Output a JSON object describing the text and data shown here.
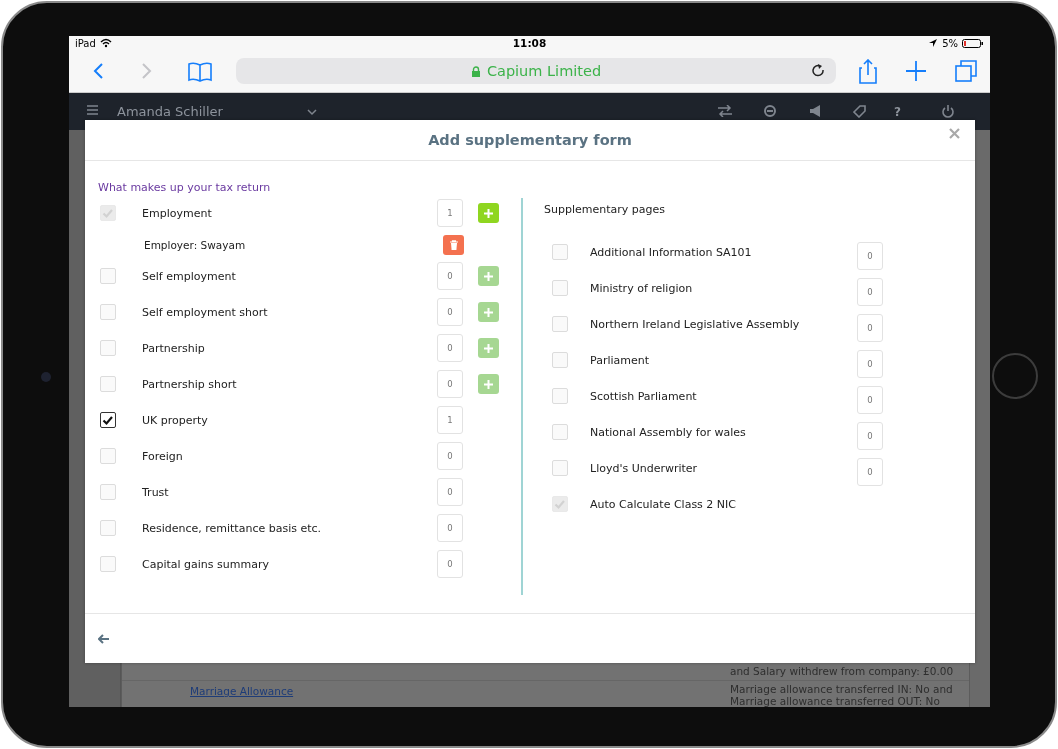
{
  "status_bar": {
    "carrier": "iPad",
    "time": "11:08",
    "battery": "5%"
  },
  "browser": {
    "address": "Capium Limited"
  },
  "app_header": {
    "user": "Amanda Schiller",
    "help": "?"
  },
  "modal": {
    "title": "Add supplementary form",
    "left": {
      "title": "What makes up your tax return",
      "items": [
        {
          "kind": "item",
          "label": "Employment",
          "checked": true,
          "disabled": true,
          "count": "1",
          "add": {
            "disabled": false
          }
        },
        {
          "kind": "sub",
          "label": "Employer: Swayam"
        },
        {
          "kind": "item",
          "label": "Self employment",
          "checked": false,
          "disabled": false,
          "count": "0",
          "add": {
            "disabled": true
          }
        },
        {
          "kind": "item",
          "label": "Self employment short",
          "checked": false,
          "disabled": false,
          "count": "0",
          "add": {
            "disabled": true
          }
        },
        {
          "kind": "item",
          "label": "Partnership",
          "checked": false,
          "disabled": false,
          "count": "0",
          "add": {
            "disabled": true
          }
        },
        {
          "kind": "item",
          "label": "Partnership short",
          "checked": false,
          "disabled": false,
          "count": "0",
          "add": {
            "disabled": true
          }
        },
        {
          "kind": "item",
          "label": "UK property",
          "checked": true,
          "disabled": false,
          "count": "1"
        },
        {
          "kind": "item",
          "label": "Foreign",
          "checked": false,
          "disabled": false,
          "count": "0"
        },
        {
          "kind": "item",
          "label": "Trust",
          "checked": false,
          "disabled": false,
          "count": "0"
        },
        {
          "kind": "item",
          "label": "Residence, remittance basis etc.",
          "checked": false,
          "disabled": false,
          "count": "0"
        },
        {
          "kind": "item",
          "label": "Capital gains summary",
          "checked": false,
          "disabled": false,
          "count": "0"
        }
      ]
    },
    "right": {
      "title": "Supplementary pages",
      "items": [
        {
          "label": "Additional Information SA101",
          "checked": false,
          "disabled": false,
          "count": "0"
        },
        {
          "label": "Ministry of religion",
          "checked": false,
          "disabled": false,
          "count": "0"
        },
        {
          "label": "Northern Ireland Legislative Assembly",
          "checked": false,
          "disabled": false,
          "count": "0"
        },
        {
          "label": "Parliament",
          "checked": false,
          "disabled": false,
          "count": "0"
        },
        {
          "label": "Scottish Parliament",
          "checked": false,
          "disabled": false,
          "count": "0"
        },
        {
          "label": "National Assembly for wales",
          "checked": false,
          "disabled": false,
          "count": "0"
        },
        {
          "label": "Lloyd's Underwriter",
          "checked": false,
          "disabled": false,
          "count": "0"
        },
        {
          "label": "Auto Calculate Class 2 NIC",
          "checked": true,
          "disabled": true
        }
      ]
    }
  },
  "background": {
    "salary_note": "and Salary withdrew from company: £0.00",
    "link": "Marriage Allowance",
    "note_lines": [
      "Marriage allowance transferred IN: No and",
      "Marriage allowance transferred OUT: No"
    ]
  }
}
